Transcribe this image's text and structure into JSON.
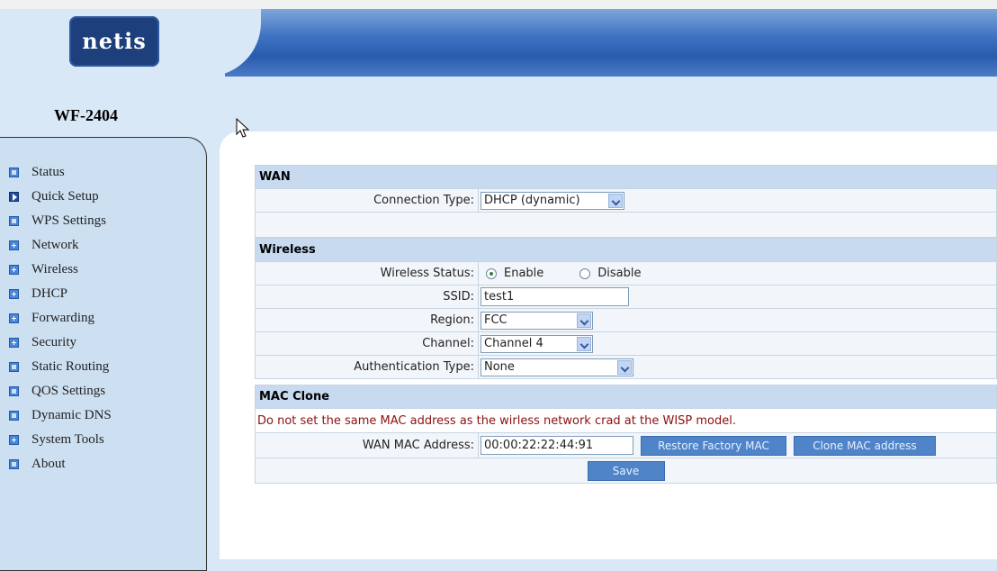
{
  "brand": {
    "logo_text": "netis",
    "model": "WF-2404"
  },
  "nav": [
    {
      "label": "Status",
      "icon": "page-icon",
      "kind": "square"
    },
    {
      "label": "Quick Setup",
      "icon": "arrow-icon",
      "kind": "arrow"
    },
    {
      "label": "WPS Settings",
      "icon": "page-icon",
      "kind": "square"
    },
    {
      "label": "Network",
      "icon": "expand-icon",
      "kind": "plus"
    },
    {
      "label": "Wireless",
      "icon": "expand-icon",
      "kind": "plus"
    },
    {
      "label": "DHCP",
      "icon": "expand-icon",
      "kind": "plus"
    },
    {
      "label": "Forwarding",
      "icon": "expand-icon",
      "kind": "plus"
    },
    {
      "label": "Security",
      "icon": "expand-icon",
      "kind": "plus"
    },
    {
      "label": "Static Routing",
      "icon": "page-icon",
      "kind": "square"
    },
    {
      "label": "QOS Settings",
      "icon": "page-icon",
      "kind": "square"
    },
    {
      "label": "Dynamic DNS",
      "icon": "page-icon",
      "kind": "square"
    },
    {
      "label": "System Tools",
      "icon": "expand-icon",
      "kind": "plus"
    },
    {
      "label": "About",
      "icon": "page-icon",
      "kind": "square"
    }
  ],
  "wan": {
    "title": "WAN",
    "connection_type_label": "Connection Type:",
    "connection_type_value": "DHCP (dynamic)"
  },
  "wireless": {
    "title": "Wireless",
    "status_label": "Wireless Status:",
    "enable_label": "Enable",
    "disable_label": "Disable",
    "ssid_label": "SSID:",
    "ssid_value": "test1",
    "region_label": "Region:",
    "region_value": "FCC",
    "channel_label": "Channel:",
    "channel_value": "Channel 4",
    "auth_label": "Authentication Type:",
    "auth_value": "None"
  },
  "mac_clone": {
    "title": "MAC Clone",
    "warning": "Do not set the same MAC address as the wirless network crad at the WISP model.",
    "wan_mac_label": "WAN MAC Address:",
    "wan_mac_value": "00:00:22:22:44:91",
    "restore_button": "Restore Factory MAC",
    "clone_button": "Clone MAC address"
  },
  "save_button": "Save",
  "colors": {
    "header_blue": "#2a5cae",
    "sidebar_bg": "#cde0f2",
    "section_header": "#c7daf0",
    "button_blue": "#4f84c9",
    "warning_red": "#8b1010"
  }
}
